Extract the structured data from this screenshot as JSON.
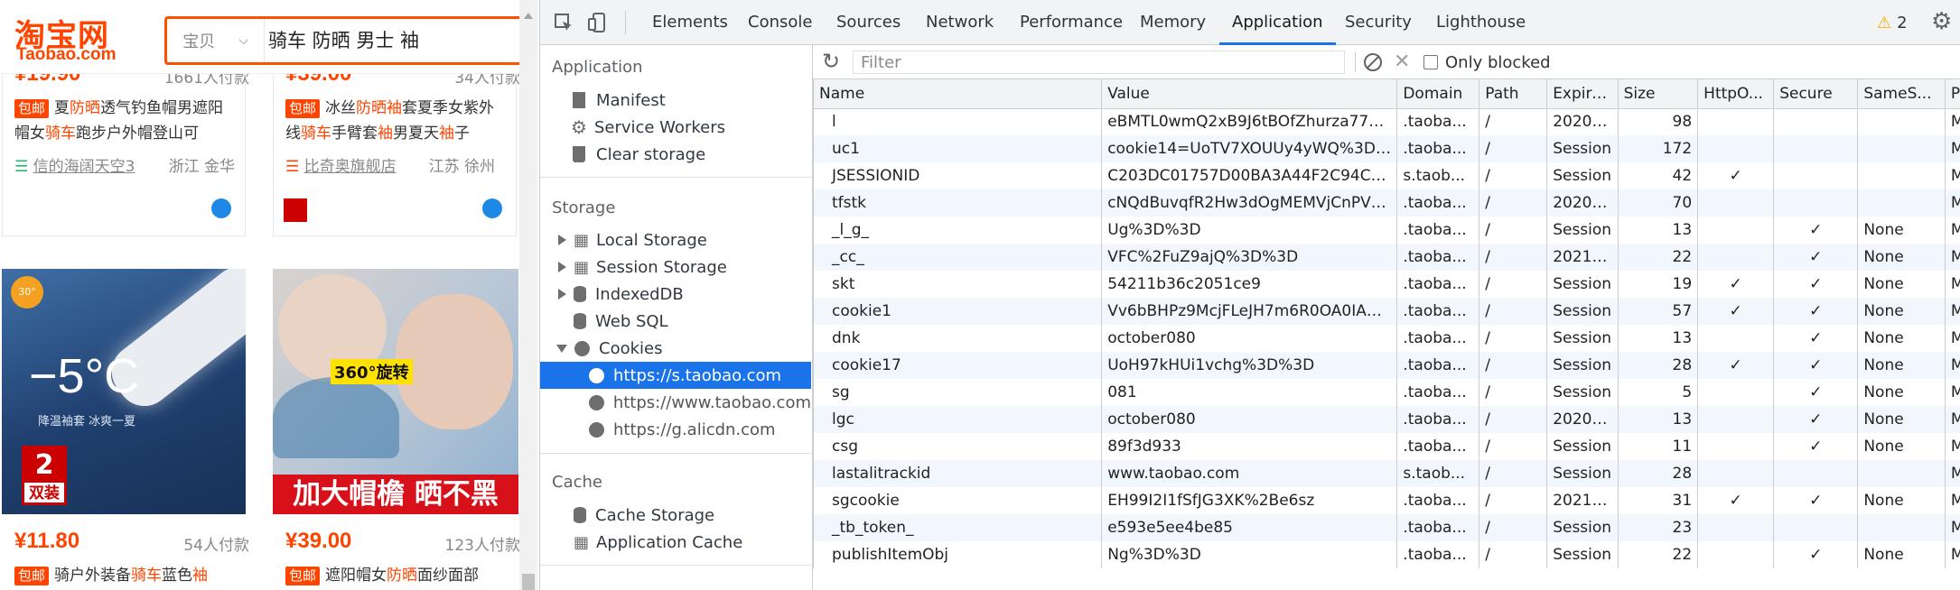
{
  "taobao": {
    "logo_cn": "淘宝网",
    "logo_en": "Taobao.com",
    "search_category": "宝贝",
    "search_query": "骑车 防晒 男士 袖",
    "top_cards": [
      {
        "price": "¥19.90",
        "paid": "1661人付款",
        "tag": "包邮",
        "desc_parts": [
          "夏",
          "防晒",
          "透气钓鱼帽男遮阳帽女",
          "骑车",
          "跑步户外帽登山可"
        ],
        "shop": "信的海阔天空3",
        "location": "浙江 金华"
      },
      {
        "price": "¥39.00",
        "paid": "34人付款",
        "tag": "包邮",
        "desc_parts": [
          "冰丝",
          "防晒袖",
          "套夏季女紫外线",
          "骑车",
          "手臂套",
          "袖",
          "男夏天",
          "袖",
          "子"
        ],
        "shop": "比奇奥旗舰店",
        "location": "江苏 徐州"
      }
    ],
    "bottom_cards": [
      {
        "badge": "30°",
        "hero_text": "−5°C",
        "sub_text": "降温袖套 冰爽一夏",
        "promo_num": "2",
        "promo_text": "双装",
        "price": "¥11.80",
        "paid": "54人付款",
        "tag": "包邮",
        "desc_parts": [
          "骑户外装备",
          "骑车",
          "蓝色",
          "袖"
        ]
      },
      {
        "rotate_label": "360°旋转",
        "banner_text": "加大帽檐  晒不黑",
        "price": "¥39.00",
        "paid": "123人付款",
        "tag": "包邮",
        "desc_parts": [
          "遮阳帽女",
          "防晒",
          "面纱面部"
        ]
      }
    ]
  },
  "devtools": {
    "tabs": [
      "Elements",
      "Console",
      "Sources",
      "Network",
      "Performance",
      "Memory",
      "Application",
      "Security",
      "Lighthouse"
    ],
    "active_tab": "Application",
    "warning_count": "2",
    "sidebar": {
      "application_header": "Application",
      "application_items": [
        "Manifest",
        "Service Workers",
        "Clear storage"
      ],
      "storage_header": "Storage",
      "storage_items": [
        "Local Storage",
        "Session Storage",
        "IndexedDB",
        "Web SQL",
        "Cookies"
      ],
      "cookie_domains": [
        "https://s.taobao.com",
        "https://www.taobao.com",
        "https://g.alicdn.com"
      ],
      "cache_header": "Cache",
      "cache_items": [
        "Cache Storage",
        "Application Cache"
      ]
    },
    "filter_placeholder": "Filter",
    "only_blocked_label": "Only blocked",
    "columns": [
      "Name",
      "Value",
      "Domain",
      "Path",
      "Expire...",
      "Size",
      "HttpO...",
      "Secure",
      "SameS...",
      "P"
    ],
    "rows": [
      [
        "l",
        "eBMTL0wmQ2xB9J6tBOfZhurza77OsIRY6uPza...",
        ".taoba...",
        "/",
        "2020-...",
        "98",
        "",
        "",
        "",
        "M"
      ],
      [
        "uc1",
        "cookie14=UoTV7XOUUy4yWQ%3D%3D&cook...",
        ".taoba...",
        "/",
        "Session",
        "172",
        "",
        "",
        "",
        "M"
      ],
      [
        "JSESSIONID",
        "C203DC01757D00BA3A44F2C94CFC531D",
        "s.taob...",
        "/",
        "Session",
        "42",
        "✓",
        "",
        "",
        "M"
      ],
      [
        "tfstk",
        "cNQdBuvqfR2Hw3dOgMEMVjCnPV5daKhkUk9...",
        ".taoba...",
        "/",
        "2020-...",
        "70",
        "",
        "",
        "",
        "M"
      ],
      [
        "_l_g_",
        "Ug%3D%3D",
        ".taoba...",
        "/",
        "Session",
        "13",
        "",
        "✓",
        "None",
        "M"
      ],
      [
        "_cc_",
        "VFC%2FuZ9ajQ%3D%3D",
        ".taoba...",
        "/",
        "2021-...",
        "22",
        "",
        "✓",
        "None",
        "M"
      ],
      [
        "skt",
        "54211b36c2051ce9",
        ".taoba...",
        "/",
        "Session",
        "19",
        "✓",
        "✓",
        "None",
        "M"
      ],
      [
        "cookie1",
        "Vv6bBHPz9McjFLeJH7m6R0OA0IA%2FGUZ%57...",
        ".taoba...",
        "/",
        "Session",
        "57",
        "✓",
        "✓",
        "None",
        "M"
      ],
      [
        "dnk",
        "october080",
        ".taoba...",
        "/",
        "Session",
        "13",
        "",
        "✓",
        "None",
        "M"
      ],
      [
        "cookie17",
        "UoH97kHUi1vchg%3D%3D",
        ".taoba...",
        "/",
        "Session",
        "28",
        "✓",
        "✓",
        "None",
        "M"
      ],
      [
        "sg",
        "081",
        ".taoba...",
        "/",
        "Session",
        "5",
        "",
        "✓",
        "None",
        "M"
      ],
      [
        "lgc",
        "october080",
        ".taoba...",
        "/",
        "2020-...",
        "13",
        "",
        "✓",
        "None",
        "M"
      ],
      [
        "csg",
        "89f3d933",
        ".taoba...",
        "/",
        "Session",
        "11",
        "",
        "✓",
        "None",
        "M"
      ],
      [
        "lastalitrackid",
        "www.taobao.com",
        "s.taob...",
        "/",
        "Session",
        "28",
        "",
        "",
        "",
        "M"
      ],
      [
        "sgcookie",
        "EH99I2I1fSfJG3XK%2Be6sz",
        ".taoba...",
        "/",
        "2021-...",
        "31",
        "✓",
        "✓",
        "None",
        "M"
      ],
      [
        "_tb_token_",
        "e593e5ee4be85",
        ".taoba...",
        "/",
        "Session",
        "23",
        "",
        "",
        "",
        "M"
      ],
      [
        "publishItemObj",
        "Ng%3D%3D",
        ".taoba...",
        "/",
        "Session",
        "22",
        "",
        "✓",
        "None",
        "M"
      ]
    ],
    "colors": {
      "accent": "#1a73e8",
      "taobao_orange": "#ff4400",
      "warning": "#f9ab00"
    }
  }
}
